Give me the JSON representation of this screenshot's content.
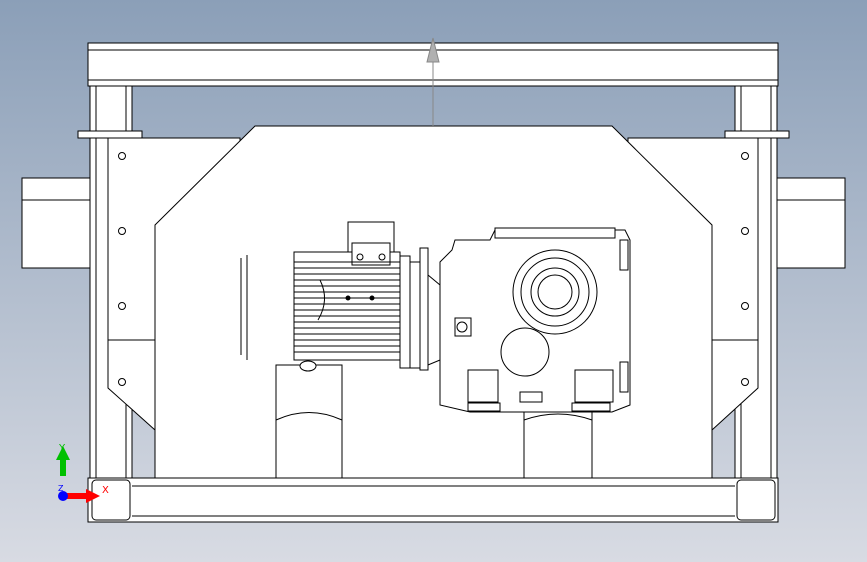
{
  "viewport": {
    "background_top": "#8b9fb8",
    "background_bottom": "#d8dbe3",
    "line_color": "#000000",
    "fill_color": "#ffffff"
  },
  "triad": {
    "x_label": "X",
    "y_label": "Y",
    "z_label": "Z",
    "x_color": "#ff0000",
    "y_color": "#00c000",
    "z_color": "#0000ff"
  }
}
